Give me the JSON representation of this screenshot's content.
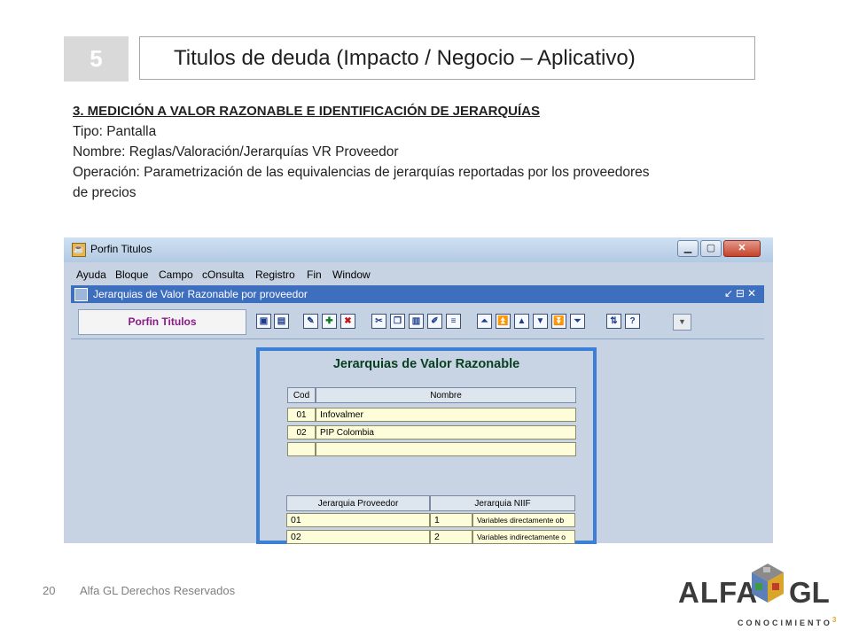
{
  "slide": {
    "number": "5",
    "title": "Titulos de deuda (Impacto / Negocio – Aplicativo)"
  },
  "description": {
    "heading": "3. MEDICIÓN A VALOR RAZONABLE E IDENTIFICACIÓN DE JERARQUÍAS",
    "line1": "Tipo: Pantalla",
    "line2": "Nombre: Reglas/Valoración/Jerarquías VR Proveedor",
    "line3": "Operación: Parametrización de las equivalencias de jerarquías reportadas por los proveedores",
    "line4": "de precios"
  },
  "app": {
    "window_title": "Porfin Titulos",
    "menu": [
      "Ayuda",
      "Bloque",
      "Campo",
      "cOnsulta",
      "Registro",
      "Fin",
      "Window"
    ],
    "inner_title": "Jerarquias de Valor Razonable por proveedor",
    "toolbar_label": "Porfin Titulos",
    "toolbar_icons": [
      "save-icon",
      "print-icon",
      "edit-icon",
      "add-icon",
      "delete-icon",
      "cut-icon",
      "copy-icon",
      "paste-icon",
      "edit-field-icon",
      "list-icon",
      "first-record-icon",
      "prev-block-icon",
      "prev-record-icon",
      "next-record-icon",
      "next-block-icon",
      "last-record-icon",
      "swap-icon",
      "help-icon",
      "dropdown-icon"
    ]
  },
  "form": {
    "title": "Jerarquias de Valor Razonable",
    "table1": {
      "headers": [
        "Cod",
        "Nombre"
      ],
      "rows": [
        {
          "cod": "01",
          "nombre": "Infovalmer"
        },
        {
          "cod": "02",
          "nombre": "PIP Colombia"
        }
      ]
    },
    "table2": {
      "headers": [
        "Jerarquia Proveedor",
        "Jerarquia NIIF"
      ],
      "rows": [
        {
          "proveedor": "01",
          "niif": "1",
          "desc": "Variables directamente ob"
        },
        {
          "proveedor": "02",
          "niif": "2",
          "desc": "Variables indirectamente o"
        }
      ]
    }
  },
  "footer": {
    "page": "20",
    "text": "Alfa GL Derechos Reservados"
  },
  "logo": {
    "left": "ALFA",
    "right": "GL",
    "sub": "CONOCIMIENTO",
    "sup": "3"
  }
}
